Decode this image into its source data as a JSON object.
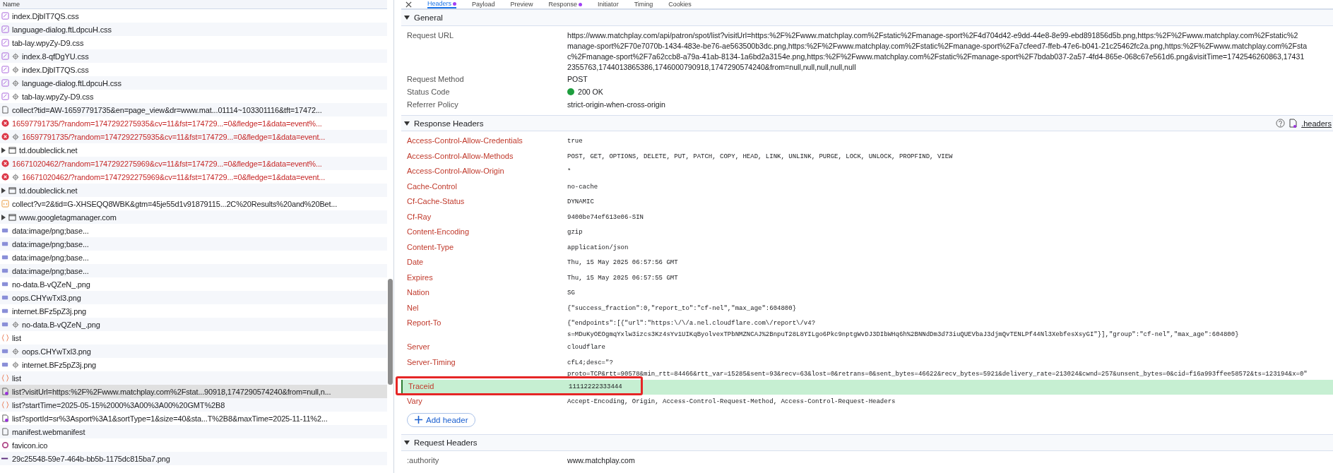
{
  "requests": {
    "column": "Name",
    "rows": [
      {
        "kind": "css",
        "service_worker": false,
        "selected": false,
        "name": "index.DjbIT7QS.css"
      },
      {
        "kind": "css",
        "service_worker": false,
        "selected": false,
        "name": "language-dialog.ftLdpcuH.css"
      },
      {
        "kind": "css",
        "service_worker": false,
        "selected": false,
        "name": "tab-lay.wpyZy-D9.css"
      },
      {
        "kind": "css",
        "service_worker": true,
        "selected": false,
        "name": "index.8-qfDgYU.css"
      },
      {
        "kind": "css",
        "service_worker": true,
        "selected": false,
        "name": "index.DjbIT7QS.css"
      },
      {
        "kind": "css",
        "service_worker": true,
        "selected": false,
        "name": "language-dialog.ftLdpcuH.css"
      },
      {
        "kind": "css",
        "service_worker": true,
        "selected": false,
        "name": "tab-lay.wpyZy-D9.css"
      },
      {
        "kind": "doc",
        "service_worker": false,
        "selected": false,
        "name": "collect?tid=AW-16597791735&en=page_view&dr=www.mat...01114~103301116&tft=17472..."
      },
      {
        "kind": "error",
        "service_worker": false,
        "selected": false,
        "name": "16597791735/?random=1747292275935&cv=11&fst=174729...=0&fledge=1&data=event%..."
      },
      {
        "kind": "error",
        "service_worker": true,
        "selected": false,
        "name": "16597791735/?random=1747292275935&cv=11&fst=174729...=0&fledge=1&data=event..."
      },
      {
        "kind": "frame",
        "service_worker": false,
        "selected": false,
        "expanded": false,
        "name": "td.doubleclick.net"
      },
      {
        "kind": "error",
        "service_worker": false,
        "selected": false,
        "name": "16671020462/?random=1747292275969&cv=11&fst=174729...=0&fledge=1&data=event%..."
      },
      {
        "kind": "error",
        "service_worker": true,
        "selected": false,
        "name": "16671020462/?random=1747292275969&cv=11&fst=174729...=0&fledge=1&data=event..."
      },
      {
        "kind": "frame",
        "service_worker": false,
        "selected": false,
        "expanded": false,
        "name": "td.doubleclick.net"
      },
      {
        "kind": "script",
        "service_worker": false,
        "selected": false,
        "name": "collect?v=2&tid=G-XHSEQQ8WBK&gtm=45je55d1v91879115...2C%20Results%20and%20Bet..."
      },
      {
        "kind": "frame",
        "service_worker": false,
        "selected": false,
        "expanded": false,
        "name": "www.googletagmanager.com"
      },
      {
        "kind": "image",
        "service_worker": false,
        "selected": false,
        "name": "data:image/png;base..."
      },
      {
        "kind": "image",
        "service_worker": false,
        "selected": false,
        "name": "data:image/png;base..."
      },
      {
        "kind": "image",
        "service_worker": false,
        "selected": false,
        "name": "data:image/png;base..."
      },
      {
        "kind": "image",
        "service_worker": false,
        "selected": false,
        "name": "data:image/png;base..."
      },
      {
        "kind": "image",
        "service_worker": false,
        "selected": false,
        "name": "no-data.B-vQZeN_.png"
      },
      {
        "kind": "image",
        "service_worker": false,
        "selected": false,
        "name": "oops.CHYwTxl3.png"
      },
      {
        "kind": "image",
        "service_worker": false,
        "selected": false,
        "name": "internet.BFz5pZ3j.png"
      },
      {
        "kind": "image",
        "service_worker": true,
        "selected": false,
        "name": "no-data.B-vQZeN_.png"
      },
      {
        "kind": "fetch",
        "service_worker": false,
        "selected": false,
        "name": "list"
      },
      {
        "kind": "image",
        "service_worker": true,
        "selected": false,
        "name": "oops.CHYwTxl3.png"
      },
      {
        "kind": "image",
        "service_worker": true,
        "selected": false,
        "name": "internet.BFz5pZ3j.png"
      },
      {
        "kind": "fetch",
        "service_worker": false,
        "selected": false,
        "name": "list"
      },
      {
        "kind": "xhr",
        "service_worker": false,
        "selected": true,
        "name": "list?visitUrl=https:%2F%2Fwww.matchplay.com%2Fstat...90918,1747290574240&from=null,n..."
      },
      {
        "kind": "fetch",
        "service_worker": false,
        "selected": false,
        "name": "list?startTime=2025-05-15%2000%3A00%3A00%20GMT%2B8"
      },
      {
        "kind": "xhr",
        "service_worker": false,
        "selected": false,
        "name": "list?sportId=sr%3Asport%3A1&sortType=1&size=40&sta...T%2B8&maxTime=2025-11-11%2..."
      },
      {
        "kind": "doc",
        "service_worker": false,
        "selected": false,
        "name": "manifest.webmanifest"
      },
      {
        "kind": "favicon",
        "service_worker": false,
        "selected": false,
        "name": "favicon.ico"
      },
      {
        "kind": "line",
        "service_worker": false,
        "selected": false,
        "name": "29c25548-59e7-464b-bb5b-1175dc815ba7.png"
      }
    ]
  },
  "tabs": [
    {
      "label": "Headers",
      "selected": true,
      "dot": true
    },
    {
      "label": "Payload",
      "selected": false,
      "dot": false
    },
    {
      "label": "Preview",
      "selected": false,
      "dot": false
    },
    {
      "label": "Response",
      "selected": false,
      "dot": true
    },
    {
      "label": "Initiator",
      "selected": false,
      "dot": false
    },
    {
      "label": "Timing",
      "selected": false,
      "dot": false
    },
    {
      "label": "Cookies",
      "selected": false,
      "dot": false
    }
  ],
  "general": {
    "title": "General",
    "expanded": true,
    "rows": [
      {
        "name": "Request URL",
        "lines": [
          "https://www.matchplay.com/api/patron/spot/list?visitUrl=https:%2F%2Fwww.matchplay.com%2Fstatic%2Fmanage-sport%2F4d704d42-e9dd-44e8-8e99-ebd891856d5b.png,https:%2F%2Fwww.matchplay.com%2Fstatic%2",
          "manage-sport%2F70e7070b-1434-483e-be76-ae563500b3dc.png,https:%2F%2Fwww.matchplay.com%2Fstatic%2Fmanage-sport%2Fa7cfeed7-ffeb-47e6-b041-21c25462fc2a.png,https:%2F%2Fwww.matchplay.com%2Fsta",
          "c%2Fmanage-sport%2F7a62ccb8-a79a-41ab-8134-1a6bd2a3154e.png,https:%2F%2Fwww.matchplay.com%2Fstatic%2Fmanage-sport%2F7bdab037-2a57-4fd4-865e-068c67e561d6.png&visitTime=1742546260863,17431",
          "2355763,1744013865386,1746000790918,1747290574240&from=null,null,null,null,null"
        ]
      },
      {
        "name": "Request Method",
        "lines": [
          "POST"
        ]
      },
      {
        "name": "Status Code",
        "status_ok": true,
        "lines": [
          "200 OK"
        ]
      },
      {
        "name": "Referrer Policy",
        "lines": [
          "strict-origin-when-cross-origin"
        ]
      }
    ]
  },
  "response_headers": {
    "title": "Response Headers",
    "expanded": true,
    "link": ".headers",
    "rows": [
      {
        "name": "Access-Control-Allow-Credentials",
        "highlighted": false,
        "lines": [
          "true"
        ]
      },
      {
        "name": "Access-Control-Allow-Methods",
        "highlighted": false,
        "lines": [
          "POST, GET, OPTIONS, DELETE, PUT, PATCH, COPY, HEAD, LINK, UNLINK, PURGE, LOCK, UNLOCK, PROPFIND, VIEW"
        ]
      },
      {
        "name": "Access-Control-Allow-Origin",
        "highlighted": false,
        "lines": [
          "*"
        ]
      },
      {
        "name": "Cache-Control",
        "highlighted": false,
        "lines": [
          "no-cache"
        ]
      },
      {
        "name": "Cf-Cache-Status",
        "highlighted": false,
        "lines": [
          "DYNAMIC"
        ]
      },
      {
        "name": "Cf-Ray",
        "highlighted": false,
        "lines": [
          "9400be74ef613e06-SIN"
        ]
      },
      {
        "name": "Content-Encoding",
        "highlighted": false,
        "lines": [
          "gzip"
        ]
      },
      {
        "name": "Content-Type",
        "highlighted": false,
        "lines": [
          "application/json"
        ]
      },
      {
        "name": "Date",
        "highlighted": false,
        "lines": [
          "Thu, 15 May 2025 06:57:56 GMT"
        ]
      },
      {
        "name": "Expires",
        "highlighted": false,
        "lines": [
          "Thu, 15 May 2025 06:57:55 GMT"
        ]
      },
      {
        "name": "Nation",
        "highlighted": false,
        "lines": [
          "SG"
        ]
      },
      {
        "name": "Nel",
        "highlighted": false,
        "lines": [
          "{\"success_fraction\":0,\"report_to\":\"cf-nel\",\"max_age\":604800}"
        ]
      },
      {
        "name": "Report-To",
        "highlighted": false,
        "lines": [
          "{\"endpoints\":[{\"url\":\"https:\\/\\/a.nel.cloudflare.com\\/report\\/v4?",
          "s=MDuKyOEOgmqYxlw3izcs3Kz4sYv1UIKqByolvexTPbNMZNCAJ%2BnpuT28L8YILgo6Pkc9nptgWvDJ3DIbWHq6h%2BNNdDm3d73iuQUEVbaJ3djmQvTENLPf44Nl3XebfesXsyGI\"}],\"group\":\"cf-nel\",\"max_age\":604800}"
        ]
      },
      {
        "name": "Server",
        "highlighted": false,
        "lines": [
          "cloudflare"
        ]
      },
      {
        "name": "Server-Timing",
        "highlighted": false,
        "lines": [
          "cfL4;desc=\"?",
          "proto=TCP&rtt=90578&min_rtt=84466&rtt_var=15285&sent=93&recv=63&lost=0&retrans=0&sent_bytes=46622&recv_bytes=5921&delivery_rate=213024&cwnd=257&unsent_bytes=0&cid=f16a993ffee58572&ts=123194&x=0\""
        ]
      },
      {
        "name": "Traceid",
        "highlighted": true,
        "annotated": true,
        "lines": [
          "11112222333444"
        ]
      },
      {
        "name": "Vary",
        "highlighted": false,
        "lines": [
          "Accept-Encoding, Origin, Access-Control-Request-Method, Access-Control-Request-Headers"
        ]
      }
    ],
    "add_button": "Add header"
  },
  "request_headers": {
    "title": "Request Headers",
    "expanded": true,
    "rows": [
      {
        "name": ":authority",
        "lines": [
          "www.matchplay.com"
        ]
      }
    ]
  }
}
